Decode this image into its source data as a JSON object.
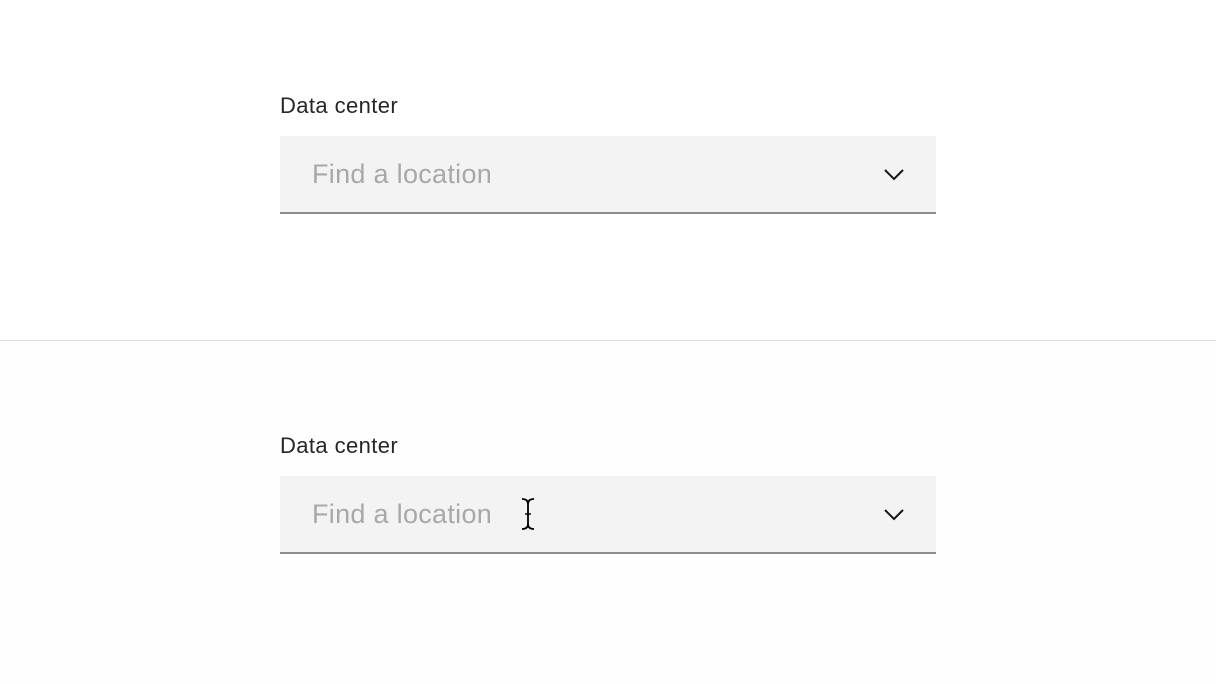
{
  "top_field": {
    "label": "Data center",
    "placeholder": "Find a location",
    "value": "",
    "icon": "chevron-down-icon"
  },
  "bottom_field": {
    "label": "Data center",
    "placeholder": "Find a location",
    "value": "",
    "icon": "chevron-down-icon",
    "cursor": "text-cursor-icon"
  },
  "colors": {
    "field_background": "#f3f3f3",
    "field_border": "#8c8c8c",
    "placeholder": "#a8a8a8",
    "label": "#262626",
    "divider": "#dcdcdc"
  }
}
